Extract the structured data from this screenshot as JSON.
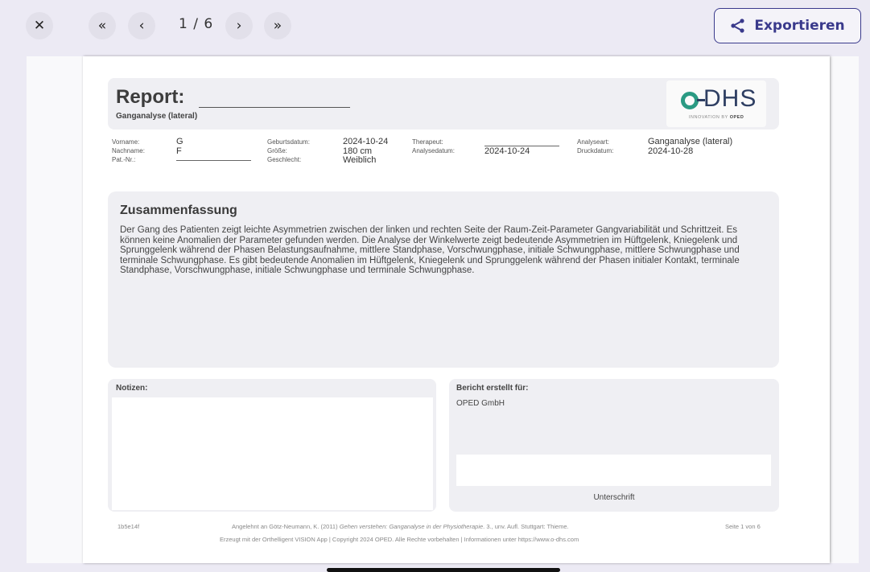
{
  "toolbar": {
    "close_icon": "close-icon",
    "first_icon": "double-chevron-left-icon",
    "prev_icon": "chevron-left-icon",
    "page_counter": "1 / 6",
    "next_icon": "chevron-right-icon",
    "last_icon": "double-chevron-right-icon",
    "export_label": "Exportieren",
    "export_icon": "share-icon",
    "accent_color": "#3a3a8c"
  },
  "report": {
    "title": "Report:",
    "subtitle": "Ganganalyse (lateral)",
    "logo_text": "DHS",
    "logo_tag_prefix": "INNOVATION BY ",
    "logo_tag_brand": "OPED"
  },
  "patient": {
    "vorname_label": "Vorname:",
    "vorname": "G",
    "nachname_label": "Nachname:",
    "nachname": "F",
    "patnr_label": "Pat.-Nr.:",
    "geburtsdatum_label": "Geburtsdatum:",
    "geburtsdatum": "2024-10-24",
    "groesse_label": "Größe:",
    "groesse": "180 cm",
    "geschlecht_label": "Geschlecht:",
    "geschlecht": "Weiblich",
    "therapeut_label": "Therapeut:",
    "analysedatum_label": "Analysedatum:",
    "analysedatum": "2024-10-24",
    "analyseart_label": "Analyseart:",
    "analyseart": "Ganganalyse (lateral)",
    "druckdatum_label": "Druckdatum:",
    "druckdatum": "2024-10-28"
  },
  "summary": {
    "heading": "Zusammenfassung",
    "text": "Der Gang des Patienten zeigt leichte Asymmetrien zwischen der linken und rechten Seite der Raum-Zeit-Parameter Gangvariabilität und Schrittzeit. Es können keine Anomalien der Parameter gefunden werden. Die Analyse der Winkelwerte zeigt bedeutende Asymmetrien im Hüftgelenk, Kniegelenk und Sprunggelenk während der Phasen Belastungsaufnahme, mittlere Standphase, Vorschwungphase, initiale Schwungphase, mittlere Schwungphase und terminale Schwungphase. Es gibt bedeutende Anomalien im Hüftgelenk, Kniegelenk und Sprunggelenk während der Phasen initialer Kontakt, terminale Standphase, Vorschwungphase, initiale Schwungphase und terminale Schwungphase."
  },
  "notes": {
    "label": "Notizen:"
  },
  "report_for": {
    "label": "Bericht erstellt für:",
    "value": "OPED GmbH",
    "signature_label": "Unterschrift"
  },
  "footer": {
    "id": "1b5e14f",
    "citation_prefix": "Angelehnt an Götz-Neumann, K. (2011) ",
    "citation_title": "Gehen verstehen: Ganganalyse in der Physiotherapie",
    "citation_suffix": ". 3., unv. Aufl. Stuttgart: Thieme.",
    "generated": "Erzeugt mit der Orthelligent VISION App | Copyright 2024 OPED. Alle Rechte vorbehalten | Informationen unter https://www.o-dhs.com",
    "page": "Seite 1 von 6"
  }
}
